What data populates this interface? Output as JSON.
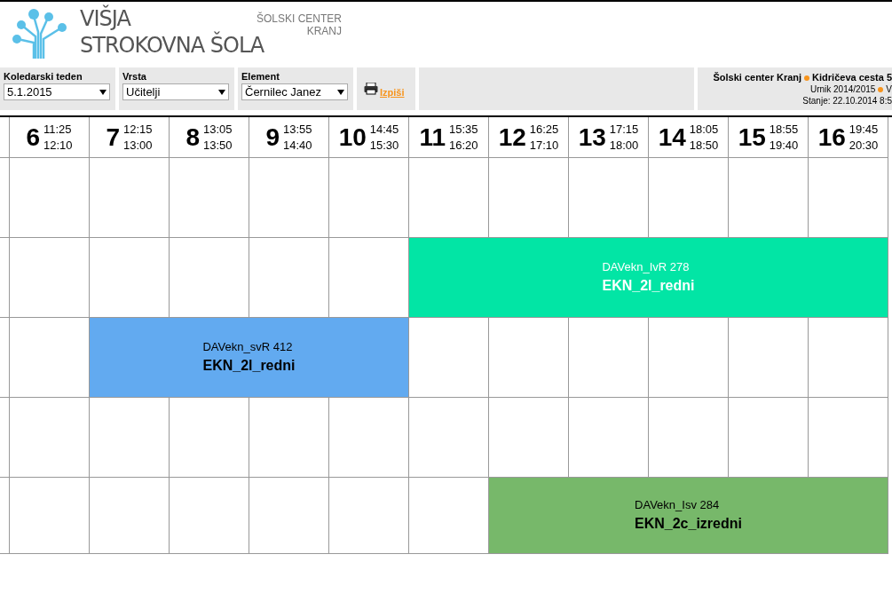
{
  "header": {
    "logo_lines": [
      "VIŠJA",
      "STROKOVNA ŠOLA"
    ],
    "center_lines": [
      "ŠOLSKI CENTER",
      "KRANJ"
    ]
  },
  "filters": [
    {
      "label": "Koledarski teden",
      "value": "5.1.2015"
    },
    {
      "label": "Vrsta",
      "value": "Učitelji"
    },
    {
      "label": "Element",
      "value": "Černilec Janez"
    }
  ],
  "print_link": "Izpiši",
  "info": {
    "lines": [
      [
        "Šolski center Kranj",
        "Kidričeva cesta 5"
      ],
      [
        "Urnik 2014/2015",
        "V"
      ],
      [
        "Stanje: 22.10.2014 8:5"
      ]
    ]
  },
  "periods": [
    {
      "number": "6",
      "start": "11:25",
      "end": "12:10"
    },
    {
      "number": "7",
      "start": "12:15",
      "end": "13:00"
    },
    {
      "number": "8",
      "start": "13:05",
      "end": "13:50"
    },
    {
      "number": "9",
      "start": "13:55",
      "end": "14:40"
    },
    {
      "number": "10",
      "start": "14:45",
      "end": "15:30"
    },
    {
      "number": "11",
      "start": "15:35",
      "end": "16:20"
    },
    {
      "number": "12",
      "start": "16:25",
      "end": "17:10"
    },
    {
      "number": "13",
      "start": "17:15",
      "end": "18:00"
    },
    {
      "number": "14",
      "start": "18:05",
      "end": "18:50"
    },
    {
      "number": "15",
      "start": "18:55",
      "end": "19:40"
    },
    {
      "number": "16",
      "start": "19:45",
      "end": "20:30"
    }
  ],
  "rows": [
    {
      "slots": [
        {
          "kind": "empty"
        },
        {
          "kind": "empty"
        },
        {
          "kind": "empty"
        },
        {
          "kind": "empty"
        },
        {
          "kind": "empty"
        },
        {
          "kind": "empty"
        },
        {
          "kind": "empty"
        },
        {
          "kind": "empty"
        },
        {
          "kind": "empty"
        },
        {
          "kind": "empty"
        },
        {
          "kind": "empty"
        }
      ]
    },
    {
      "slots": [
        {
          "kind": "empty"
        },
        {
          "kind": "empty"
        },
        {
          "kind": "empty"
        },
        {
          "kind": "empty"
        },
        {
          "kind": "empty"
        },
        {
          "kind": "lesson",
          "subject": "DAVekn_IvR",
          "room": "278",
          "group": "EKN_2l_redni",
          "color": "#02e5a5",
          "light_text": true
        },
        {
          "kind": "continued"
        },
        {
          "kind": "continued"
        },
        {
          "kind": "continued"
        },
        {
          "kind": "continued"
        },
        {
          "kind": "continued"
        }
      ]
    },
    {
      "slots": [
        {
          "kind": "empty"
        },
        {
          "kind": "lesson",
          "subject": "DAVekn_svR",
          "room": "412",
          "group": "EKN_2l_redni",
          "color": "#62aaf0",
          "light_text": false
        },
        {
          "kind": "continued"
        },
        {
          "kind": "continued"
        },
        {
          "kind": "continued"
        },
        {
          "kind": "empty"
        },
        {
          "kind": "empty"
        },
        {
          "kind": "empty"
        },
        {
          "kind": "empty"
        },
        {
          "kind": "empty"
        },
        {
          "kind": "empty"
        }
      ]
    },
    {
      "slots": [
        {
          "kind": "empty"
        },
        {
          "kind": "empty"
        },
        {
          "kind": "empty"
        },
        {
          "kind": "empty"
        },
        {
          "kind": "empty"
        },
        {
          "kind": "empty"
        },
        {
          "kind": "empty"
        },
        {
          "kind": "empty"
        },
        {
          "kind": "empty"
        },
        {
          "kind": "empty"
        },
        {
          "kind": "empty"
        }
      ]
    },
    {
      "slots": [
        {
          "kind": "empty"
        },
        {
          "kind": "empty"
        },
        {
          "kind": "empty"
        },
        {
          "kind": "empty"
        },
        {
          "kind": "empty"
        },
        {
          "kind": "empty"
        },
        {
          "kind": "lesson",
          "subject": "DAVekn_Isv",
          "room": "284",
          "group": "EKN_2c_izredni",
          "color": "#77b86a",
          "light_text": false
        },
        {
          "kind": "continued"
        },
        {
          "kind": "continued"
        },
        {
          "kind": "continued"
        },
        {
          "kind": "continued"
        }
      ]
    }
  ]
}
